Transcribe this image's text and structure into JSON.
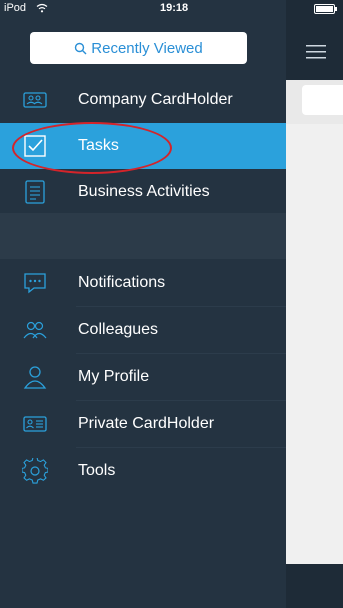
{
  "status_bar": {
    "carrier": "iPod",
    "time": "19:18"
  },
  "sidebar": {
    "search_label": "Recently Viewed",
    "items": [
      {
        "label": "Company CardHolder",
        "icon": "card-holder-icon"
      },
      {
        "label": "Tasks",
        "icon": "checkbox-icon",
        "active": true
      },
      {
        "label": "Business Activities",
        "icon": "document-list-icon"
      },
      {
        "label": "Notifications",
        "icon": "chat-bubble-icon"
      },
      {
        "label": "Colleagues",
        "icon": "people-icon"
      },
      {
        "label": "My Profile",
        "icon": "person-icon"
      },
      {
        "label": "Private CardHolder",
        "icon": "id-card-icon"
      },
      {
        "label": "Tools",
        "icon": "gear-icon"
      }
    ]
  },
  "colors": {
    "sidebar_bg": "#243341",
    "active_bg": "#2ba1dc",
    "accent": "#2a8fd6",
    "annotation": "#d4242a"
  }
}
